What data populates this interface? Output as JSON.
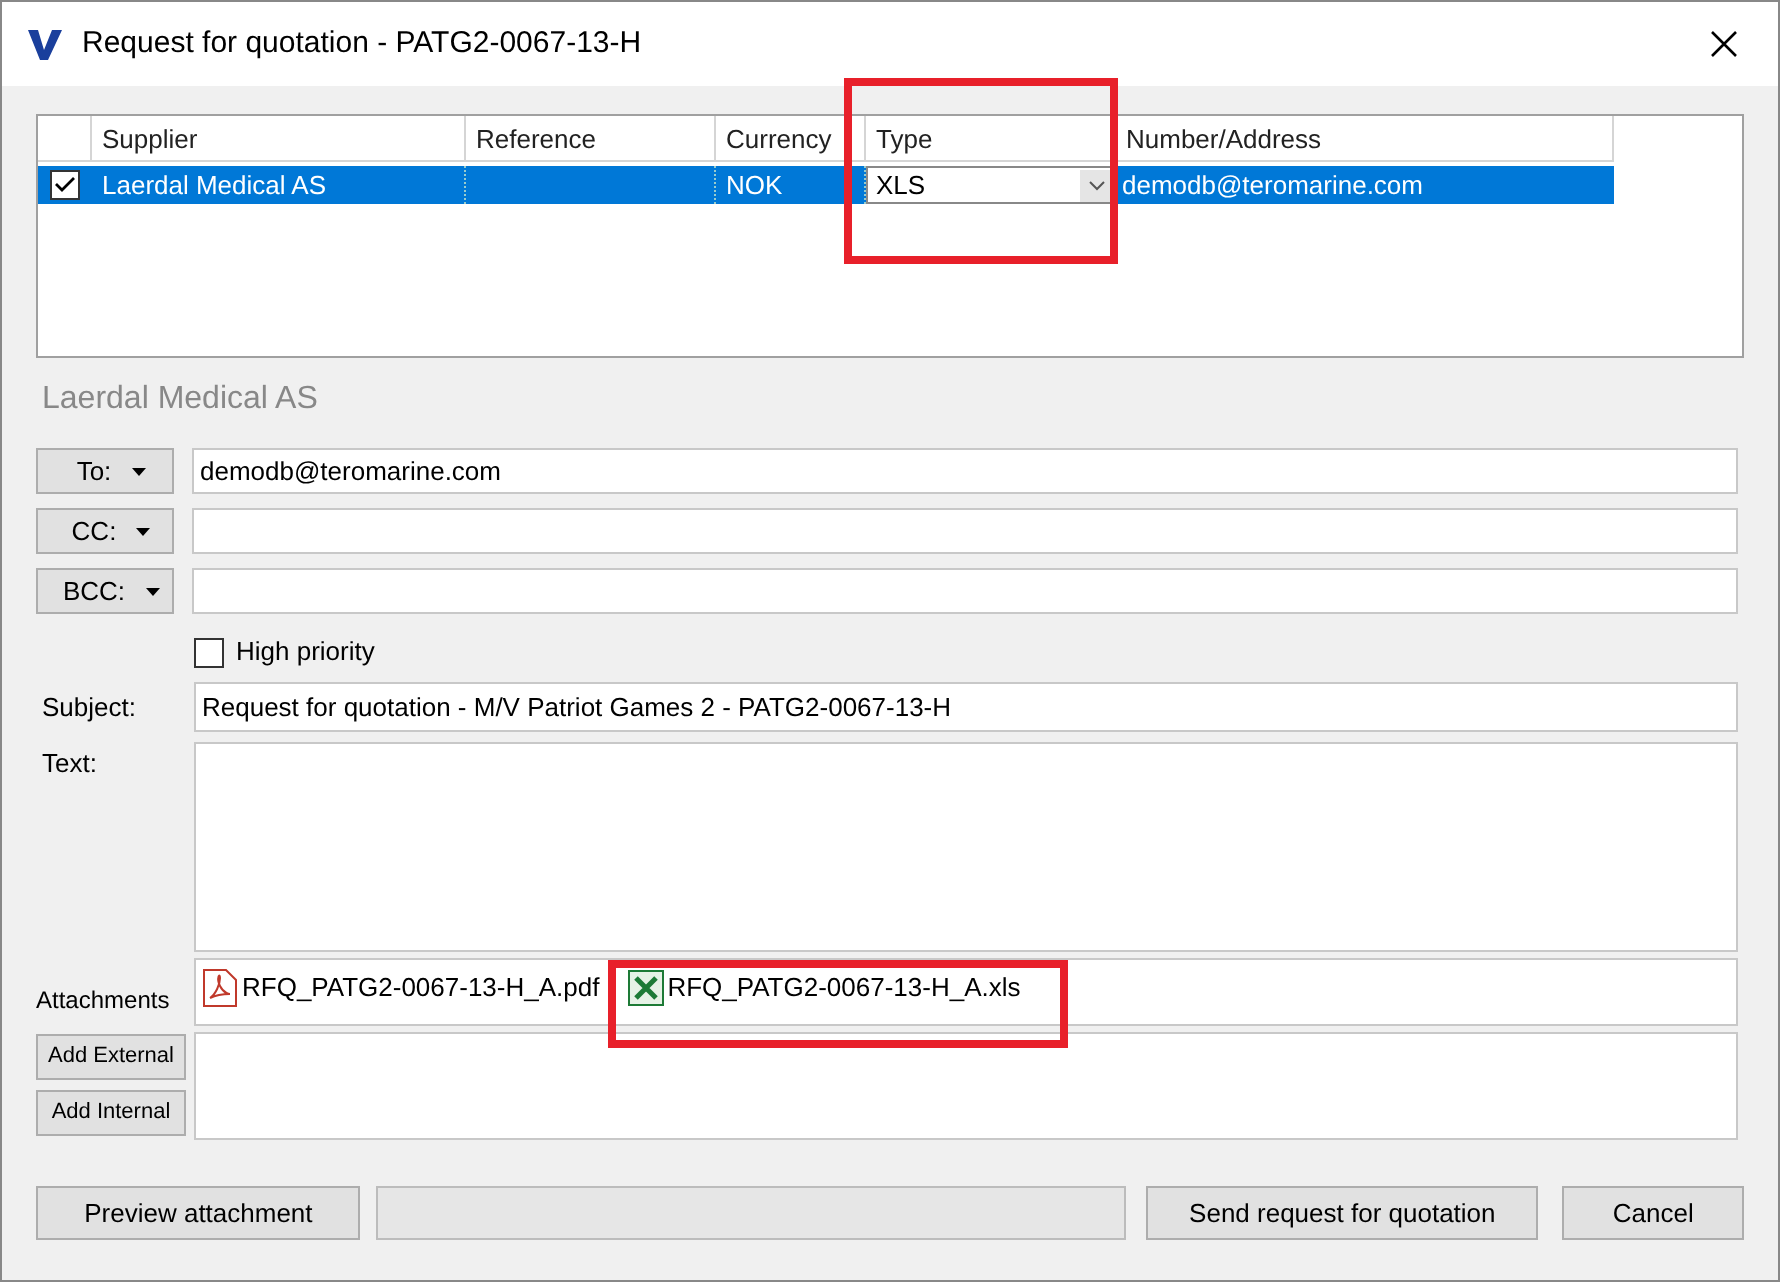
{
  "window": {
    "title": "Request for quotation - PATG2-0067-13-H"
  },
  "grid": {
    "columns": [
      "Supplier",
      "Reference",
      "Currency",
      "Type",
      "Number/Address"
    ],
    "rows": [
      {
        "checked": true,
        "selected": true,
        "supplier": "Laerdal Medical AS",
        "reference": "",
        "currency": "NOK",
        "type": "XLS",
        "address": "demodb@teromarine.com"
      }
    ]
  },
  "supplier_heading": "Laerdal Medical AS",
  "recipients": [
    {
      "label": "To:",
      "value": "demodb@teromarine.com"
    },
    {
      "label": "CC:"
    },
    {
      "label": "BCC:"
    }
  ],
  "high_priority": {
    "label": "High priority",
    "checked": false
  },
  "subject": {
    "label": "Subject:",
    "value": "Request for quotation - M/V Patriot Games 2 - PATG2-0067-13-H"
  },
  "text": {
    "label": "Text:"
  },
  "attachments": {
    "label": "Attachments",
    "files": [
      {
        "kind": "pdf",
        "name": "RFQ_PATG2-0067-13-H_A.pdf"
      },
      {
        "kind": "xls",
        "name": "RFQ_PATG2-0067-13-H_A.xls"
      }
    ],
    "buttons": [
      "Add External",
      "Add Internal"
    ]
  },
  "footer": {
    "preview": "Preview attachment",
    "progress": {
      "level": 0
    },
    "send": "Send request for quotation",
    "cancel": "Cancel"
  }
}
